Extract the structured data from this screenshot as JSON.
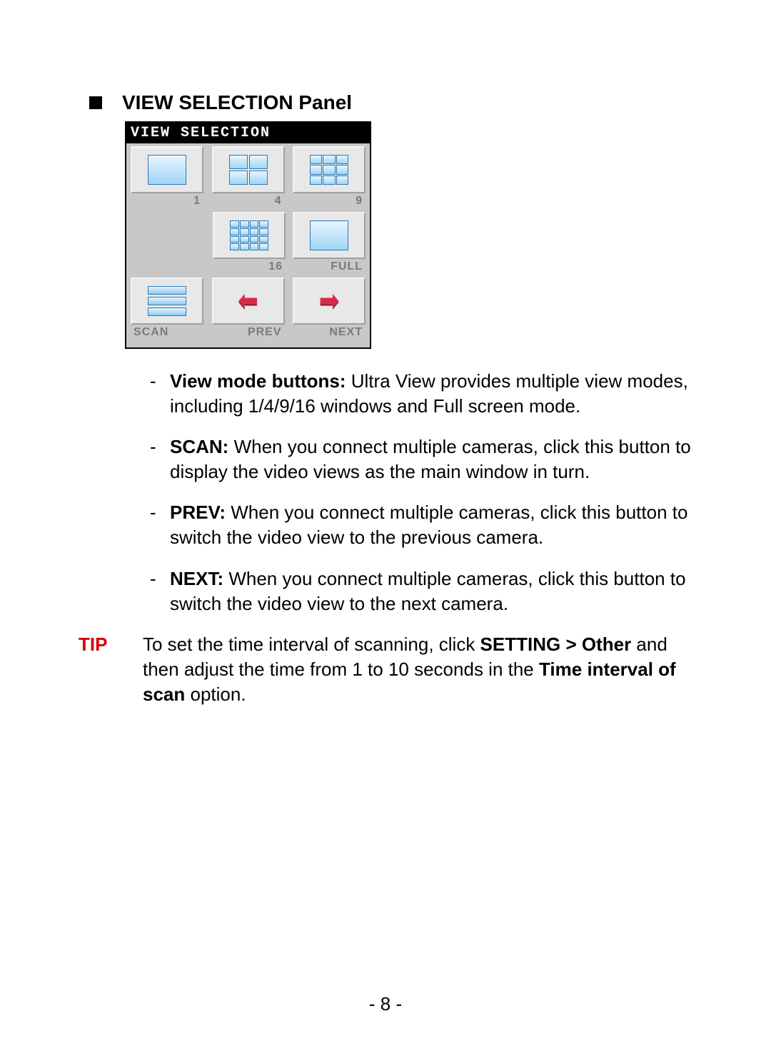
{
  "heading": "VIEW SELECTION Panel",
  "panel": {
    "header": "VIEW SELECTION",
    "buttons": {
      "v1": "1",
      "v4": "4",
      "v9": "9",
      "v16": "16",
      "full": "FULL",
      "scan": "SCAN",
      "prev": "PREV",
      "next": "NEXT"
    }
  },
  "items": [
    {
      "boldLabel": "View mode buttons:",
      "text": " Ultra View provides multiple view modes, including 1/4/9/16 windows and Full screen mode."
    },
    {
      "boldLabel": "SCAN:",
      "text": " When you connect multiple cameras, click this button to display the video views as the main window in turn."
    },
    {
      "boldLabel": "PREV:",
      "text": " When you connect multiple cameras, click this button to switch the video view to the previous camera."
    },
    {
      "boldLabel": "NEXT:",
      "text": " When you connect multiple cameras, click this button to switch the video view to the next camera."
    }
  ],
  "tip": {
    "label": "TIP",
    "pre": "To set the time interval of scanning, click ",
    "bold1": "SETTING > Other",
    "mid": " and then adjust the time from 1 to 10 seconds in the ",
    "bold2": "Time interval of scan",
    "post": " option."
  },
  "pageNumber": "- 8 -"
}
